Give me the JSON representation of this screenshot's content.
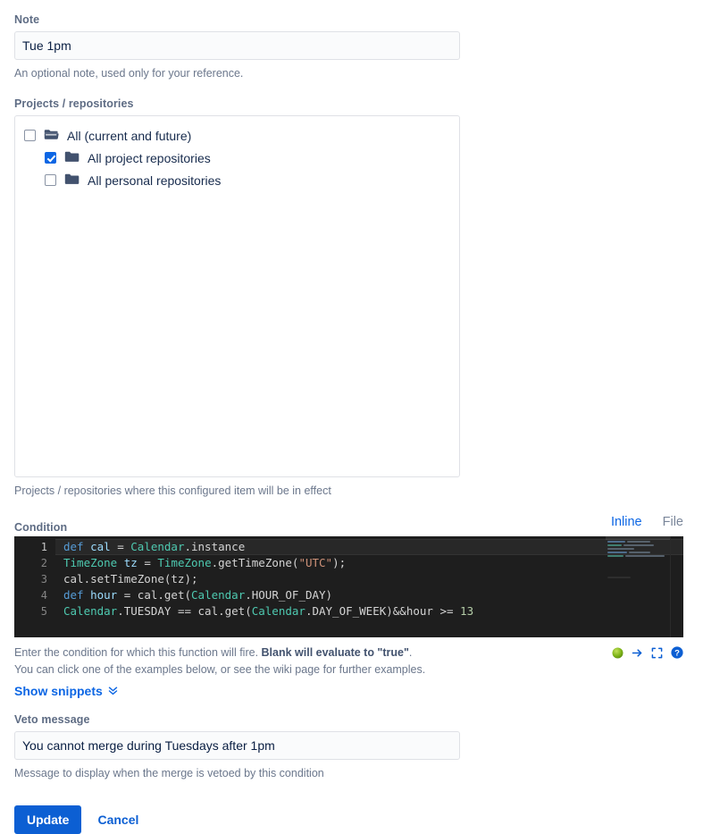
{
  "note": {
    "label": "Note",
    "value": "Tue 1pm",
    "placeholder": "",
    "help": "An optional note, used only for your reference."
  },
  "projects": {
    "label": "Projects / repositories",
    "help": "Projects / repositories where this configured item will be in effect",
    "items": [
      {
        "label": "All (current and future)",
        "checked": false,
        "indent": false,
        "icon": "folder-open-icon"
      },
      {
        "label": "All project repositories",
        "checked": true,
        "indent": true,
        "icon": "folder-icon"
      },
      {
        "label": "All personal repositories",
        "checked": false,
        "indent": true,
        "icon": "folder-icon"
      }
    ]
  },
  "condition": {
    "label": "Condition",
    "tabs": [
      {
        "label": "Inline",
        "active": true
      },
      {
        "label": "File",
        "active": false
      }
    ],
    "code_lines": [
      {
        "n": "1",
        "tokens": [
          {
            "t": "def",
            "c": "kw"
          },
          {
            "t": " ",
            "c": "pln"
          },
          {
            "t": "cal",
            "c": "var"
          },
          {
            "t": " = ",
            "c": "pln"
          },
          {
            "t": "Calendar",
            "c": "typ"
          },
          {
            "t": ".instance",
            "c": "pln"
          }
        ]
      },
      {
        "n": "2",
        "tokens": [
          {
            "t": "TimeZone",
            "c": "typ"
          },
          {
            "t": " ",
            "c": "pln"
          },
          {
            "t": "tz",
            "c": "var"
          },
          {
            "t": " = ",
            "c": "pln"
          },
          {
            "t": "TimeZone",
            "c": "typ"
          },
          {
            "t": ".getTimeZone(",
            "c": "pln"
          },
          {
            "t": "\"UTC\"",
            "c": "str"
          },
          {
            "t": ");",
            "c": "pln"
          }
        ]
      },
      {
        "n": "3",
        "tokens": [
          {
            "t": "cal.setTimeZone(tz);",
            "c": "pln"
          }
        ]
      },
      {
        "n": "4",
        "tokens": [
          {
            "t": "def",
            "c": "kw"
          },
          {
            "t": " ",
            "c": "pln"
          },
          {
            "t": "hour",
            "c": "var"
          },
          {
            "t": " = cal.get(",
            "c": "pln"
          },
          {
            "t": "Calendar",
            "c": "typ"
          },
          {
            "t": ".HOUR_OF_DAY)",
            "c": "pln"
          }
        ]
      },
      {
        "n": "5",
        "tokens": [
          {
            "t": "Calendar",
            "c": "typ"
          },
          {
            "t": ".TUESDAY == cal.get(",
            "c": "pln"
          },
          {
            "t": "Calendar",
            "c": "typ"
          },
          {
            "t": ".DAY_OF_WEEK)&&hour >= ",
            "c": "pln"
          },
          {
            "t": "13",
            "c": "num"
          }
        ]
      }
    ],
    "help_line_1_plain": "Enter the condition for which this function will fire. ",
    "help_line_1_bold": "Blank will evaluate to \"true\"",
    "help_line_1_tail": ".",
    "help_line_2": "You can click one of the examples below, or see the wiki page for further examples.",
    "snippets_label": "Show snippets",
    "icons": [
      {
        "name": "status-ok-icon",
        "title": ""
      },
      {
        "name": "run-arrow-icon",
        "title": ""
      },
      {
        "name": "fullscreen-icon",
        "title": ""
      },
      {
        "name": "help-icon",
        "title": ""
      }
    ]
  },
  "veto": {
    "label": "Veto message",
    "value": "You cannot merge during Tuesdays after 1pm",
    "placeholder": "",
    "help": "Message to display when the merge is vetoed by this condition"
  },
  "actions": {
    "submit_label": "Update",
    "cancel_label": "Cancel"
  },
  "colors": {
    "accent": "#0C66E4",
    "primary_button": "#0C5FD3",
    "editor_bg": "#1E1E1E",
    "label": "#5E6C84",
    "help": "#6B778C",
    "folder": "#42526E",
    "status_ok": "#7AB317"
  }
}
